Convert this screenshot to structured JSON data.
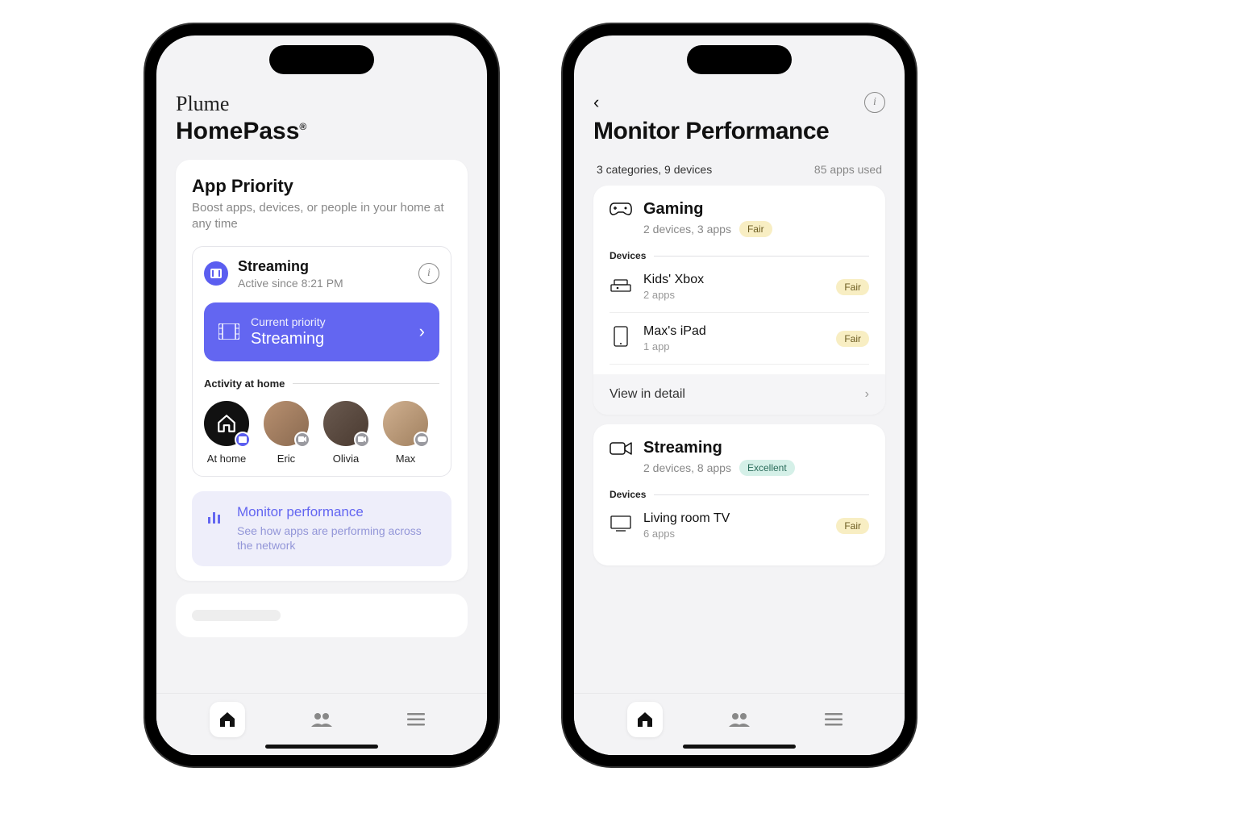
{
  "left": {
    "brand": "Plume",
    "brandSub": "HomePass",
    "brandReg": "®",
    "priorityCard": {
      "title": "App Priority",
      "subtitle": "Boost apps, devices, or people in your home at any time",
      "streamingTitle": "Streaming",
      "streamingSub": "Active since 8:21 PM",
      "currentPriorityLabel": "Current priority",
      "currentPriorityValue": "Streaming"
    },
    "activityLabel": "Activity at home",
    "people": [
      {
        "name": "At home"
      },
      {
        "name": "Eric"
      },
      {
        "name": "Olivia"
      },
      {
        "name": "Max"
      }
    ],
    "monitor": {
      "title": "Monitor performance",
      "sub": "See how apps are performing across the network"
    }
  },
  "right": {
    "title": "Monitor Performance",
    "metaLeft": "3 categories, 9 devices",
    "metaRight": "85 apps used",
    "gaming": {
      "title": "Gaming",
      "sub": "2 devices, 3 apps",
      "badge": "Fair",
      "devicesLabel": "Devices",
      "dev1Name": "Kids' Xbox",
      "dev1Sub": "2 apps",
      "dev1Badge": "Fair",
      "dev2Name": "Max's iPad",
      "dev2Sub": "1 app",
      "dev2Badge": "Fair",
      "detail": "View in detail"
    },
    "streaming": {
      "title": "Streaming",
      "sub": "2 devices, 8 apps",
      "badge": "Excellent",
      "devicesLabel": "Devices",
      "dev1Name": "Living room TV",
      "dev1Sub": "6 apps",
      "dev1Badge": "Fair"
    }
  }
}
